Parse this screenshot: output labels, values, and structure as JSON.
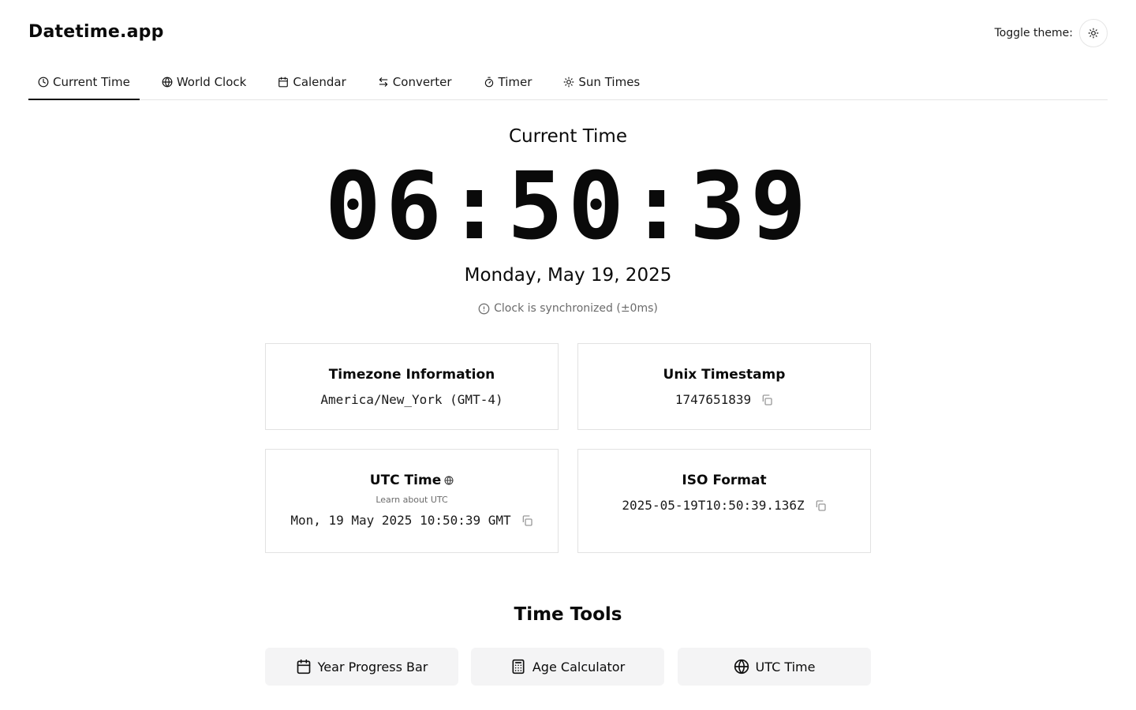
{
  "app": {
    "brand": "Datetime.app",
    "theme_label": "Toggle theme:",
    "theme_icon": "sun-icon"
  },
  "tabs": [
    {
      "label": "Current Time",
      "icon": "clock-icon",
      "active": true
    },
    {
      "label": "World Clock",
      "icon": "globe-icon"
    },
    {
      "label": "Calendar",
      "icon": "calendar-icon"
    },
    {
      "label": "Converter",
      "icon": "arrows-icon"
    },
    {
      "label": "Timer",
      "icon": "timer-icon"
    },
    {
      "label": "Sun Times",
      "icon": "sun-icon"
    }
  ],
  "current": {
    "title": "Current Time",
    "time": "06:50:39",
    "date": "Monday, May 19, 2025",
    "sync": "Clock is synchronized (±0ms)"
  },
  "cards": {
    "timezone": {
      "title": "Timezone Information",
      "value": "America/New_York (GMT-4)"
    },
    "unix": {
      "title": "Unix Timestamp",
      "value": "1747651839"
    },
    "utc": {
      "title": "UTC Time",
      "sub": "Learn about UTC",
      "value": "Mon, 19 May 2025 10:50:39 GMT"
    },
    "iso": {
      "title": "ISO Format",
      "value": "2025-05-19T10:50:39.136Z"
    }
  },
  "tools": {
    "title": "Time Tools",
    "items": [
      {
        "label": "Year Progress Bar",
        "icon": "calendar-icon"
      },
      {
        "label": "Age Calculator",
        "icon": "calculator-icon"
      },
      {
        "label": "UTC Time",
        "icon": "globe-icon"
      }
    ]
  }
}
